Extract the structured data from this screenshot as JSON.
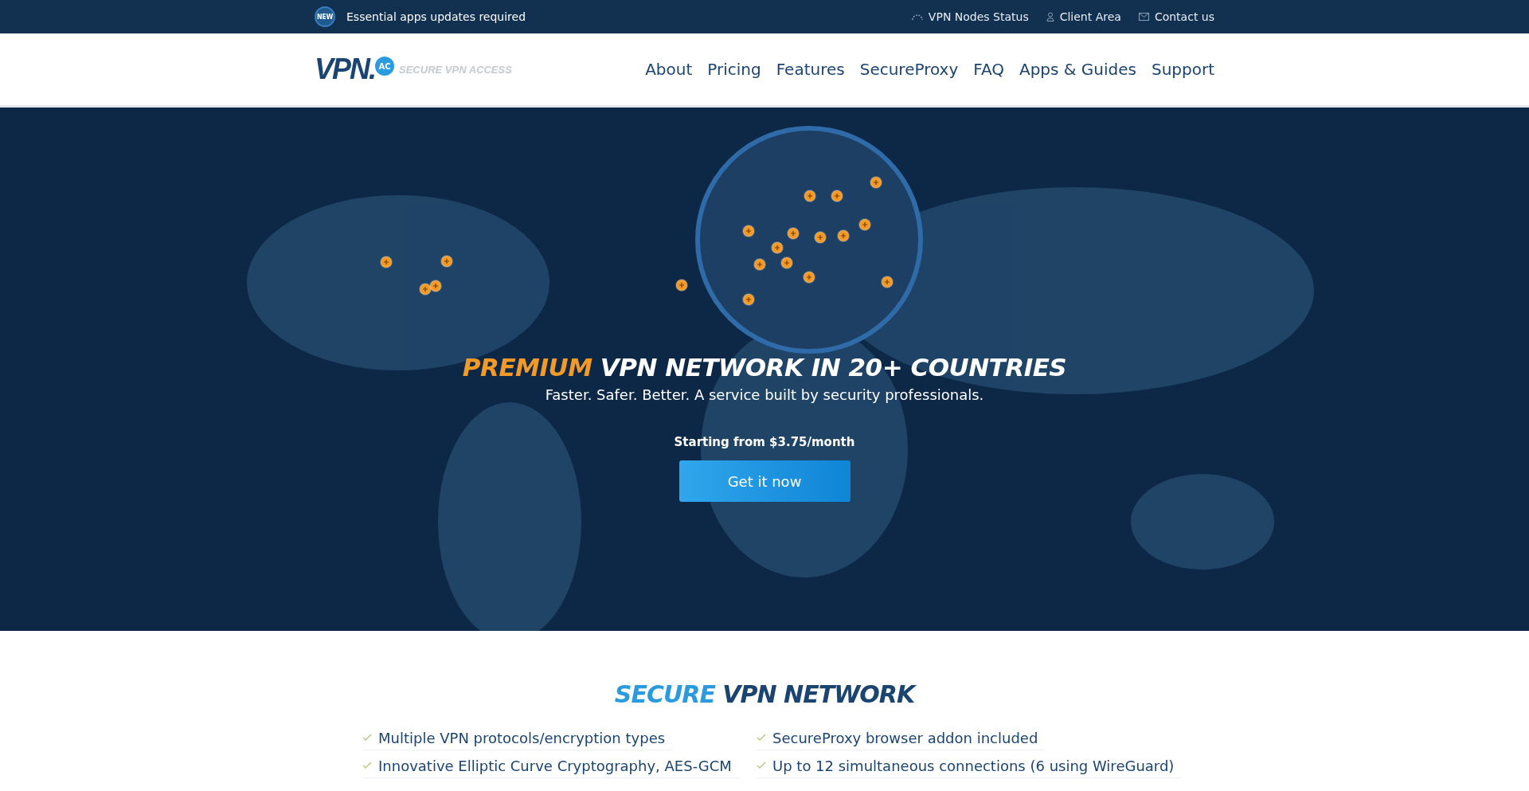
{
  "top_bar": {
    "badge": "NEW",
    "notice": "Essential apps updates required",
    "links": [
      {
        "kind": "status",
        "label": "VPN Nodes Status"
      },
      {
        "kind": "user",
        "label": "Client Area"
      },
      {
        "kind": "mail",
        "label": "Contact us"
      }
    ]
  },
  "header": {
    "logo": {
      "name": "VPN.",
      "badge": "AC",
      "tagline": "SECURE VPN ACCESS"
    },
    "nav": [
      "About",
      "Pricing",
      "Features",
      "SecureProxy",
      "FAQ",
      "Apps & Guides",
      "Support"
    ]
  },
  "hero": {
    "title_highlight": "PREMIUM",
    "title_rest": "VPN NETWORK IN 20+ COUNTRIES",
    "subtitle": "Faster. Safer. Better. A service built by security professionals.",
    "price_note": "Starting from $3.75/month",
    "cta": "Get it now"
  },
  "features": {
    "title_highlight": "SECURE",
    "title_rest": "VPN NETWORK",
    "items": [
      {
        "text": "Multiple VPN protocols/encryption types"
      },
      {
        "text": "SecureProxy browser addon included"
      },
      {
        "text": "Innovative Elliptic Curve Cryptography, AES-GCM"
      },
      {
        "text": "Up to 12 simultaneous connections (6 using WireGuard)"
      }
    ]
  }
}
